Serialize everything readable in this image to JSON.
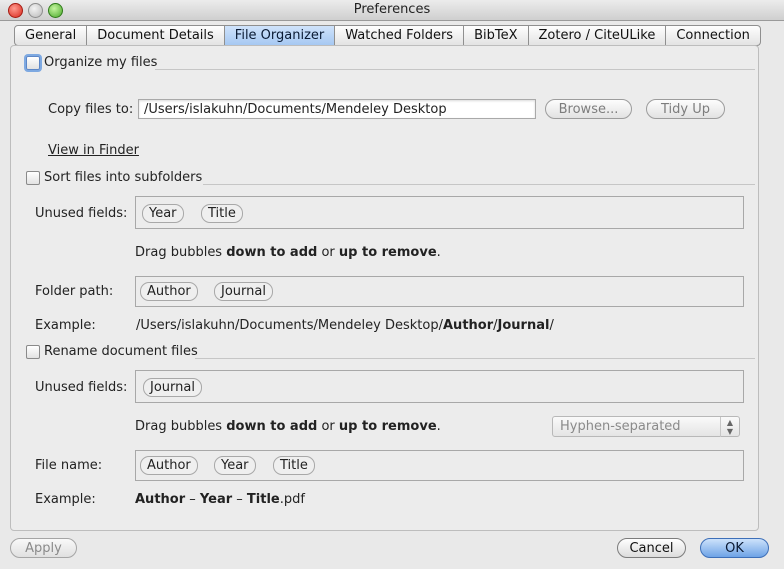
{
  "window": {
    "title": "Preferences"
  },
  "tabs": [
    {
      "label": "General"
    },
    {
      "label": "Document Details"
    },
    {
      "label": "File Organizer"
    },
    {
      "label": "Watched Folders"
    },
    {
      "label": "BibTeX"
    },
    {
      "label": "Zotero / CiteULike"
    },
    {
      "label": "Connection"
    }
  ],
  "organize": {
    "label": "Organize my files",
    "copy_label": "Copy files to:",
    "path_value": "/Users/islakuhn/Documents/Mendeley Desktop",
    "browse_label": "Browse...",
    "tidy_label": "Tidy Up",
    "finder_link": "View in Finder"
  },
  "subfolders": {
    "label": "Sort files into subfolders",
    "unused_label": "Unused fields:",
    "unused_bubbles": [
      "Year",
      "Title"
    ],
    "hint_pre": "Drag bubbles ",
    "hint_down": "down to add",
    "hint_mid": " or ",
    "hint_up": "up to remove",
    "hint_end": ".",
    "folder_label": "Folder path:",
    "folder_bubbles": [
      "Author",
      "Journal"
    ],
    "example_label": "Example:",
    "example_base": "/Users/islakuhn/Documents/Mendeley Desktop/",
    "example_author": "Author",
    "example_slash": "/",
    "example_journal": "Journal",
    "example_end": "/"
  },
  "rename": {
    "label": "Rename document files",
    "unused_label": "Unused fields:",
    "unused_bubbles": [
      "Journal"
    ],
    "hint_pre": "Drag bubbles ",
    "hint_down": "down to add",
    "hint_mid": " or ",
    "hint_up": "up to remove",
    "hint_end": ".",
    "separator_value": "Hyphen-separated",
    "file_label": "File name:",
    "file_bubbles": [
      "Author",
      "Year",
      "Title"
    ],
    "example_label": "Example:",
    "example_author": "Author",
    "example_dash1": " – ",
    "example_year": "Year",
    "example_dash2": " – ",
    "example_title": "Title",
    "example_ext": ".pdf"
  },
  "footer": {
    "apply_label": "Apply",
    "cancel_label": "Cancel",
    "ok_label": "OK"
  }
}
